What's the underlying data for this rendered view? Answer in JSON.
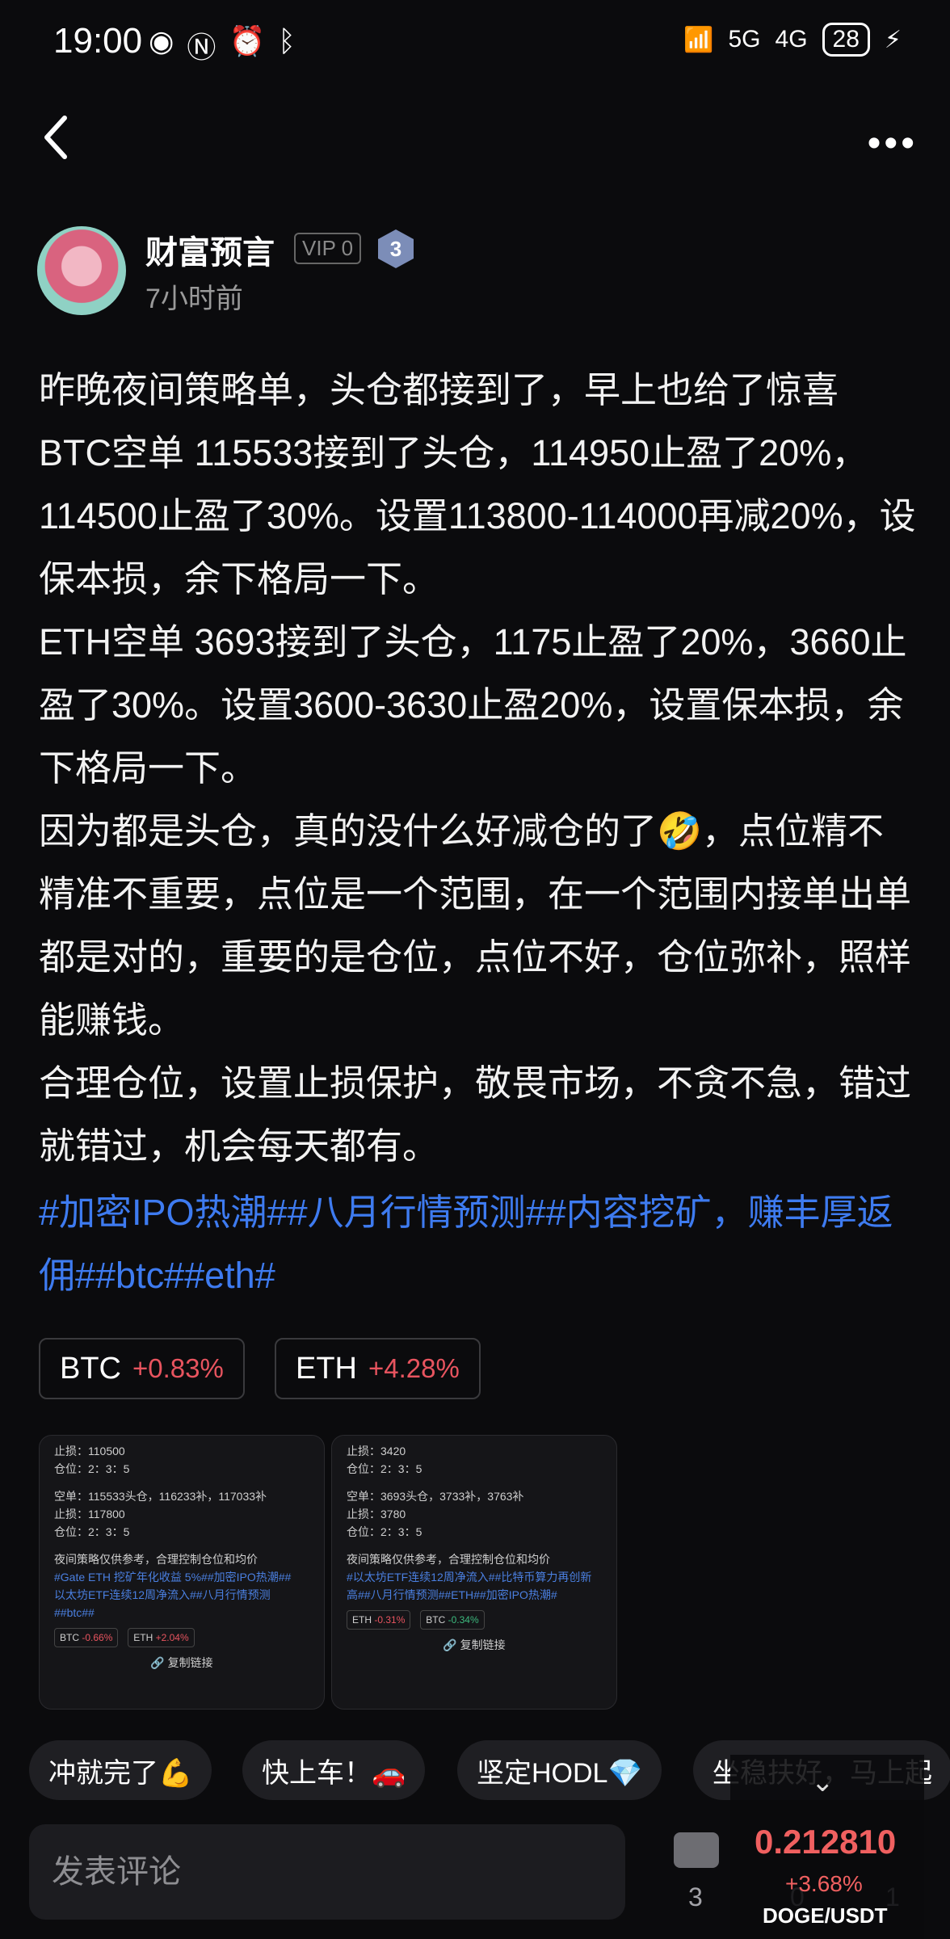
{
  "status": {
    "time": "19:00",
    "battery": "28",
    "net1": "5G",
    "net2": "4G"
  },
  "author": {
    "name": "财富预言",
    "vip": "VIP 0",
    "level": "3",
    "time_ago": "7小时前"
  },
  "post": {
    "lines": [
      "昨晚夜间策略单，头仓都接到了，早上也给了惊喜",
      "BTC空单 115533接到了头仓，114950止盈了20%，114500止盈了30%。设置113800-114000再减20%，设保本损，余下格局一下。",
      "ETH空单 3693接到了头仓，1175止盈了20%，3660止盈了30%。设置3600-3630止盈20%，设置保本损，余下格局一下。",
      "因为都是头仓，真的没什么好减仓的了🤣，点位精不精准不重要，点位是一个范围，在一个范围内接单出单都是对的，重要的是仓位，点位不好，仓位弥补，照样能赚钱。",
      "合理仓位，设置止损保护，敬畏市场，不贪不急，错过就错过，机会每天都有。"
    ],
    "tags": "#加密IPO热潮##八月行情预测##内容挖矿，赚丰厚返佣##btc##eth#"
  },
  "coins": [
    {
      "symbol": "BTC",
      "change": "+0.83%"
    },
    {
      "symbol": "ETH",
      "change": "+4.28%"
    }
  ],
  "image1": {
    "l1": "止损：110500",
    "l2": "仓位：2：3：5",
    "l3": "空单：115533头仓，116233补，117033补",
    "l4": "止损：117800",
    "l5": "仓位：2：3：5",
    "l6": "夜间策略仅供参考，合理控制仓位和均价",
    "l7": "#Gate ETH 挖矿年化收益 5%##加密IPO热潮##",
    "l8": "以太坊ETF连续12周净流入##八月行情预测",
    "l9": "##btc##",
    "c1": "BTC",
    "c1v": "-0.66%",
    "c2": "ETH",
    "c2v": "+2.04%",
    "copy": "复制链接"
  },
  "image2": {
    "l1": "止损：3420",
    "l2": "仓位：2：3：5",
    "l3": "空单：3693头仓，3733补，3763补",
    "l4": "止损：3780",
    "l5": "仓位：2：3：5",
    "l6": "夜间策略仅供参考，合理控制仓位和均价",
    "l7": "#以太坊ETF连续12周净流入##比特币算力再创新",
    "l8": "高##八月行情预测##ETH##加密IPO热潮#",
    "c1": "ETH",
    "c1v": "-0.31%",
    "c2": "BTC",
    "c2v": "-0.34%",
    "copy": "复制链接"
  },
  "quick_replies": [
    "冲就完了💪",
    "快上车！🚗",
    "坚定HODL💎",
    "坐稳扶好，马上起"
  ],
  "comment": {
    "placeholder": "发表评论",
    "comment_count": "3",
    "like_count": "0",
    "fav_count": "1"
  },
  "widget": {
    "price": "0.212810",
    "change": "+3.68%",
    "pair": "DOGE/USDT"
  },
  "colors": {
    "accent_blue": "#3e7bf0",
    "up_red": "#e8545f",
    "down_green": "#3dba7e"
  }
}
